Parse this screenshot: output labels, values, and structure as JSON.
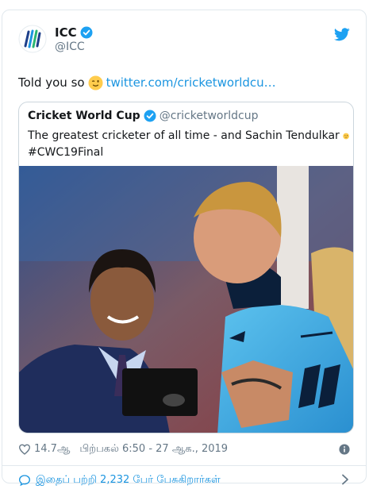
{
  "tweet": {
    "display_name": "ICC",
    "handle": "@ICC",
    "text": "Told you so",
    "link": "twitter.com/cricketworldcu…"
  },
  "quoted": {
    "display_name": "Cricket World Cup",
    "handle": "@cricketworldcup",
    "text_line1": "The greatest cricketer of all time - and Sachin Tendulkar",
    "text_line2": "#CWC19Final"
  },
  "meta": {
    "likes": "14.7ஆ",
    "timestamp": "பிற்பகல் 6:50 - 27 ஆக., 2019"
  },
  "conversation": {
    "label": "இதைப் பற்றி 2,232 பேர் பேசுகிறார்கள்"
  },
  "icons": {
    "logo": "icc-logo-icon",
    "verified": "verified-badge-icon",
    "brand": "twitter-bird-icon",
    "emoji": "winking-face-icon",
    "like": "heart-icon",
    "info": "info-icon",
    "reply": "speech-bubble-icon",
    "more": "chevron-right-icon"
  },
  "colors": {
    "accent": "#1b95e0",
    "muted": "#657786",
    "border": "#e1e8ed"
  }
}
